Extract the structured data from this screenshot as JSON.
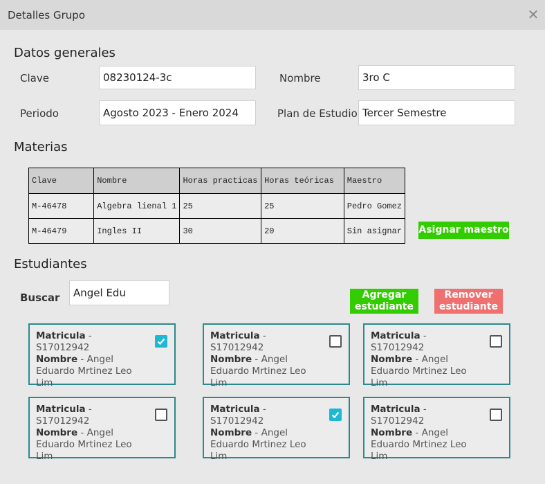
{
  "window": {
    "title": "Detalles Grupo"
  },
  "general": {
    "heading": "Datos generales",
    "clave_label": "Clave",
    "clave_value": "08230124-3c",
    "nombre_label": "Nombre",
    "nombre_value": "3ro C",
    "periodo_label": "Periodo",
    "periodo_value": "Agosto 2023 - Enero 2024",
    "plan_label": "Plan de Estudio",
    "plan_value": "Tercer Semestre"
  },
  "materias": {
    "heading": "Materias",
    "columns": [
      "Clave",
      "Nombre",
      "Horas practicas",
      "Horas teóricas",
      "Maestro"
    ],
    "rows": [
      [
        "M-46478",
        "Algebra lienal 1",
        "25",
        "25",
        "Pedro Gomez"
      ],
      [
        "M-46479",
        "Ingles II",
        "30",
        "20",
        "Sin asignar"
      ]
    ],
    "assign_button": "Asignar maestro"
  },
  "estudiantes": {
    "heading": "Estudiantes",
    "search_label": "Buscar",
    "search_value": "Angel Edu",
    "add_button": "Agregar estudiante",
    "remove_button": "Remover estudiante",
    "matricula_label": "Matricula",
    "nombre_label": "Nombre",
    "cards": [
      {
        "matricula": "S17012942",
        "nombre": "Angel Eduardo Mrtinez Leo Lim",
        "checked": true
      },
      {
        "matricula": "S17012942",
        "nombre": "Angel Eduardo Mrtinez Leo Lim",
        "checked": false
      },
      {
        "matricula": "S17012942",
        "nombre": "Angel Eduardo Mrtinez Leo Lim",
        "checked": false
      },
      {
        "matricula": "S17012942",
        "nombre": "Angel Eduardo Mrtinez Leo Lim",
        "checked": false
      },
      {
        "matricula": "S17012942",
        "nombre": "Angel Eduardo Mrtinez Leo Lim",
        "checked": true
      },
      {
        "matricula": "S17012942",
        "nombre": "Angel Eduardo Mrtinez Leo Lim",
        "checked": false
      }
    ]
  },
  "colors": {
    "accent_green": "#33cc00",
    "accent_red": "#f07070",
    "card_border": "#2a8a8f",
    "checkbox_on": "#1eb8d4"
  },
  "icons": {
    "close": "close-icon",
    "checkmark": "checkmark-icon"
  }
}
